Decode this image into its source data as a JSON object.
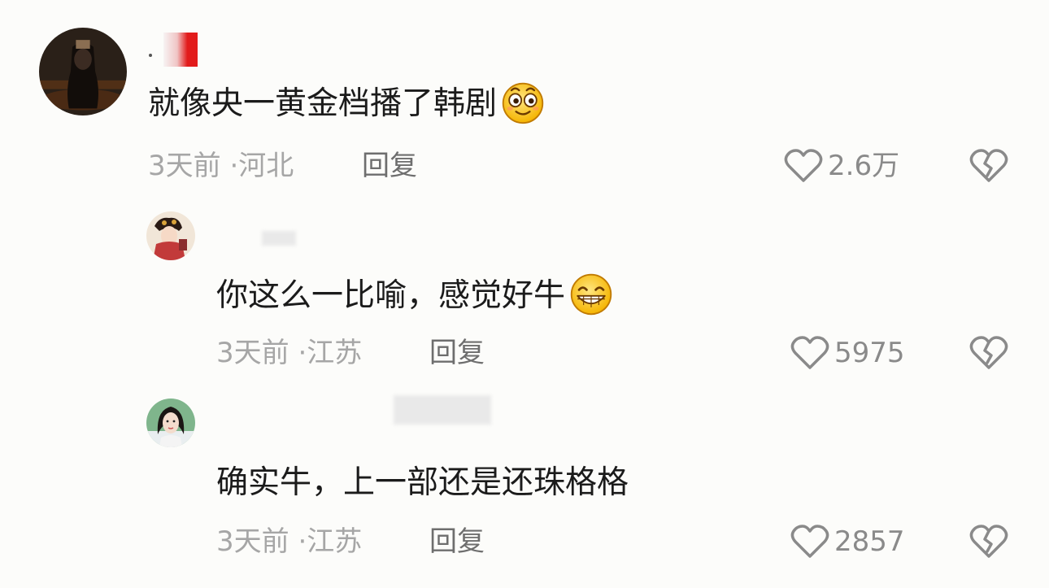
{
  "comments": [
    {
      "text": "就像央一黄金档播了韩剧",
      "emoji": "goofy-eyes-emoji",
      "time": "3天前",
      "separator": "·",
      "location": "河北",
      "reply_label": "回复",
      "likes": "2.6万"
    },
    {
      "text": "你这么一比喻，感觉好牛",
      "emoji": "grin-emoji",
      "time": "3天前",
      "separator": "·",
      "location": "江苏",
      "reply_label": "回复",
      "likes": "5975"
    },
    {
      "text": "确实牛，上一部还是还珠格格",
      "emoji": "",
      "time": "3天前",
      "separator": "·",
      "location": "江苏",
      "reply_label": "回复",
      "likes": "2857"
    }
  ],
  "icons": {
    "like": "heart-outline-icon",
    "dislike": "broken-heart-icon"
  },
  "colors": {
    "background": "#fcfcfa",
    "text": "#1b1b1b",
    "meta": "#a6a6a6",
    "icon": "#8a8a8a",
    "username_redacted_accent": "#e21b1b"
  }
}
